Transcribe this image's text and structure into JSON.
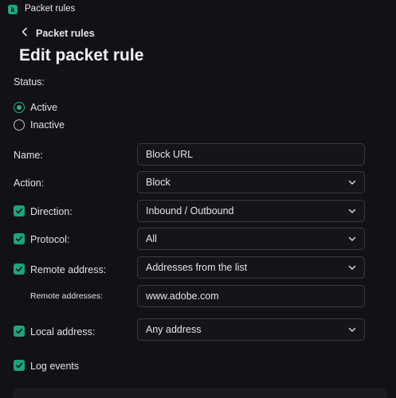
{
  "window": {
    "title": "Packet rules"
  },
  "breadcrumb": {
    "back_label": "Packet rules"
  },
  "page": {
    "title": "Edit packet rule"
  },
  "status": {
    "label": "Status:",
    "options": [
      {
        "label": "Active",
        "checked": true
      },
      {
        "label": "Inactive",
        "checked": false
      }
    ]
  },
  "form": {
    "name": {
      "label": "Name:",
      "value": "Block URL"
    },
    "action": {
      "label": "Action:",
      "value": "Block"
    },
    "direction": {
      "label": "Direction:",
      "value": "Inbound / Outbound",
      "checked": true
    },
    "protocol": {
      "label": "Protocol:",
      "value": "All",
      "checked": true
    },
    "remote_address": {
      "label": "Remote address:",
      "value": "Addresses from the list",
      "checked": true
    },
    "remote_addresses": {
      "label": "Remote addresses:",
      "value": "www.adobe.com"
    },
    "local_address": {
      "label": "Local address:",
      "value": "Any address",
      "checked": true
    },
    "log_events": {
      "label": "Log events",
      "checked": true
    }
  },
  "colors": {
    "accent": "#1fa37e",
    "background": "#121116",
    "field_border": "#3a3a44"
  }
}
